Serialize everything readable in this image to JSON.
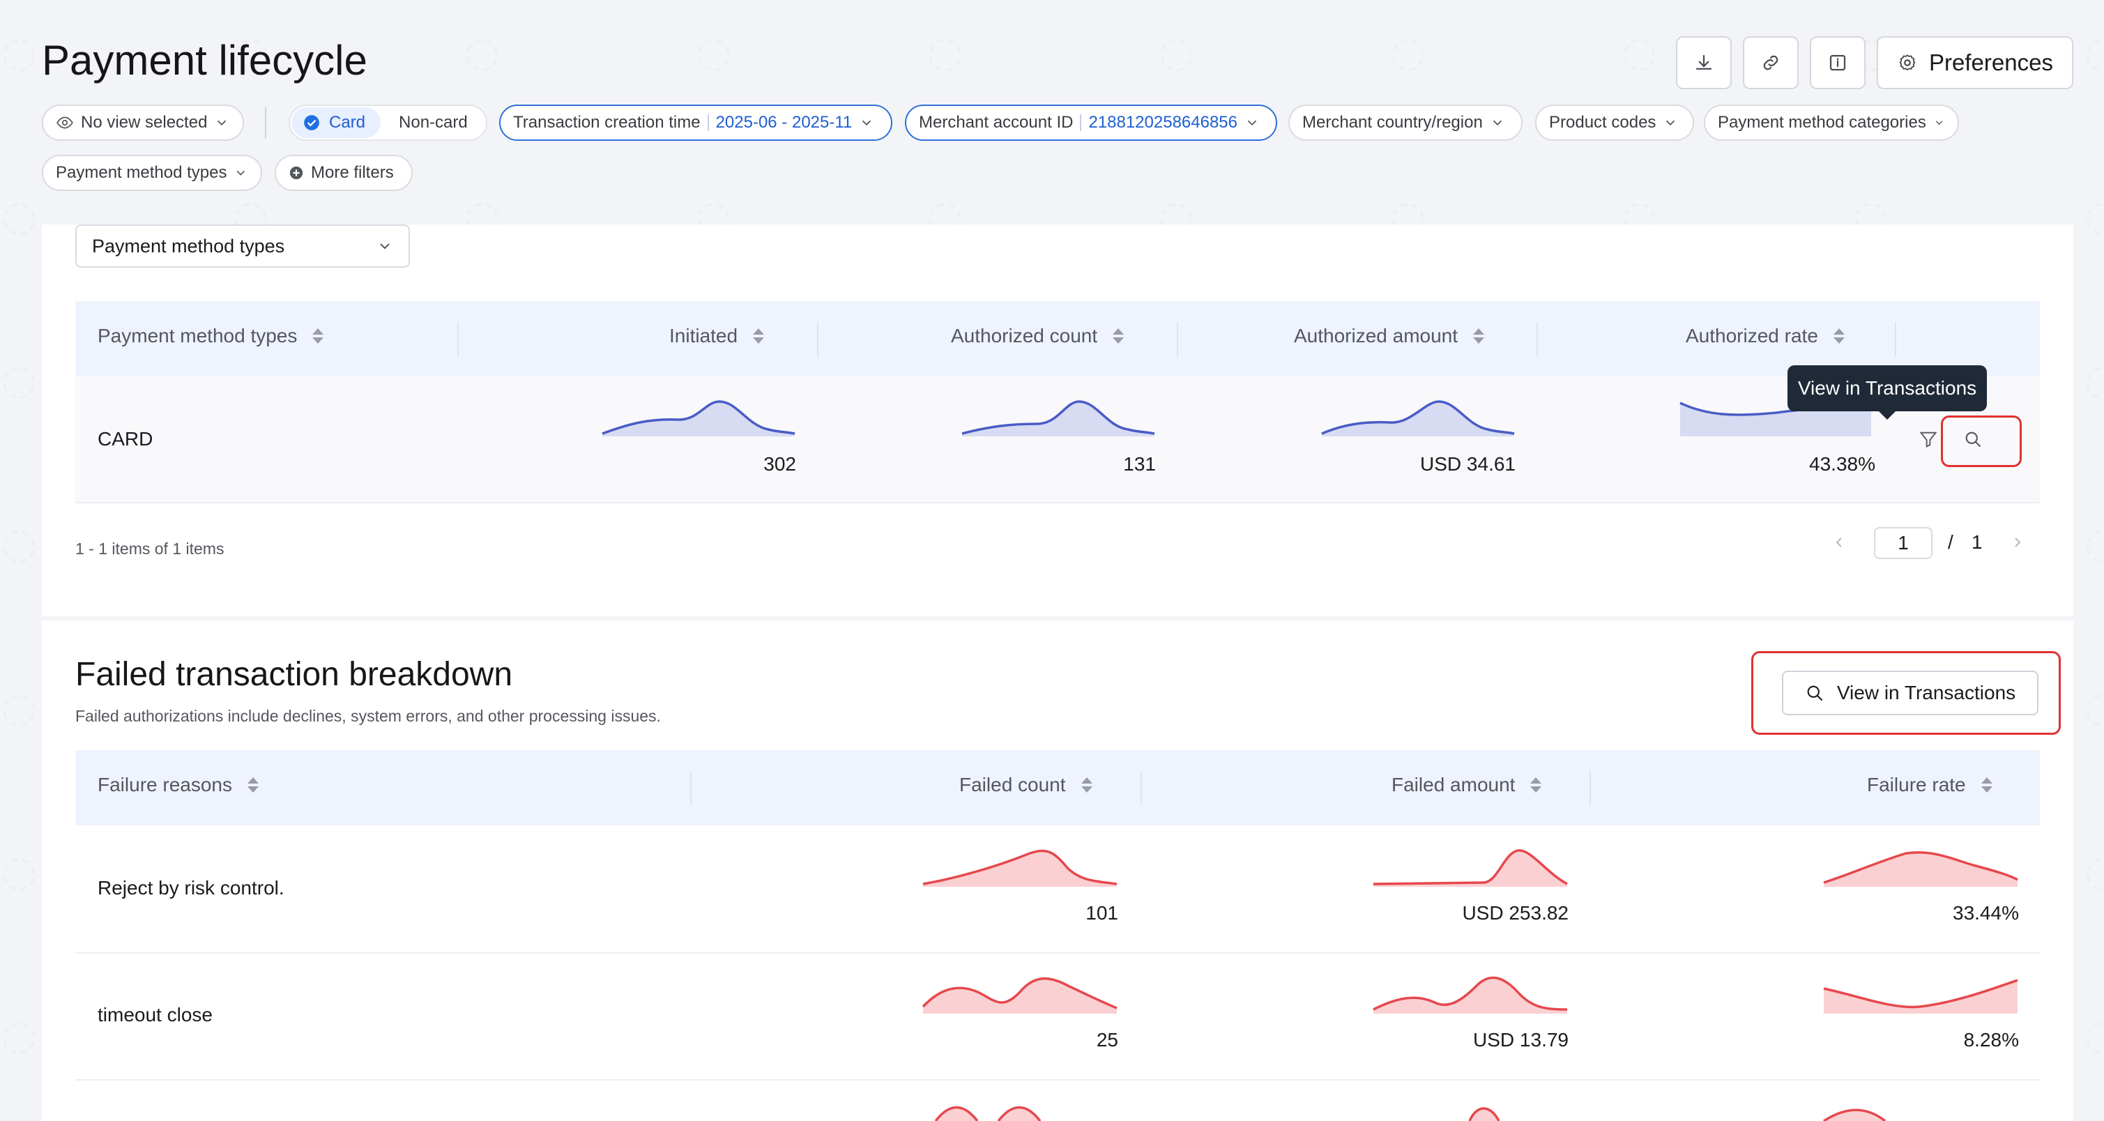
{
  "header": {
    "title": "Payment lifecycle",
    "preferences_label": "Preferences",
    "icons": [
      "download-icon",
      "link-icon",
      "info-icon",
      "gear-icon"
    ]
  },
  "filters": {
    "view_select": "No view selected",
    "segment": {
      "selected": "Card",
      "other": "Non-card"
    },
    "transaction_time": {
      "label": "Transaction creation time",
      "value": "2025-06 - 2025-11"
    },
    "merchant_account": {
      "label": "Merchant account ID",
      "value": "2188120258646856"
    },
    "merchant_country": "Merchant country/region",
    "product_codes": "Product codes",
    "payment_method_categories": "Payment method categories",
    "payment_method_types": "Payment method types",
    "more_filters": "More filters"
  },
  "dimension_select": "Payment method types",
  "pm_table": {
    "columns": [
      "Payment method types",
      "Initiated",
      "Authorized count",
      "Authorized amount",
      "Authorized rate"
    ],
    "rows": [
      {
        "name": "CARD",
        "initiated": "302",
        "authorized_count": "131",
        "authorized_amount": "USD 34.61",
        "authorized_rate": "43.38%"
      }
    ],
    "tooltip": "View in Transactions",
    "pagination_summary": "1 - 1 items of 1 items",
    "page": "1",
    "page_sep": "/",
    "total_pages": "1"
  },
  "failed": {
    "title": "Failed transaction breakdown",
    "subtitle": "Failed authorizations include declines, system errors, and other processing issues.",
    "view_button": "View in Transactions",
    "columns": [
      "Failure reasons",
      "Failed count",
      "Failed amount",
      "Failure rate"
    ],
    "rows": [
      {
        "reason": "Reject by risk control.",
        "count": "101",
        "amount": "USD 253.82",
        "rate": "33.44%"
      },
      {
        "reason": "timeout close",
        "count": "25",
        "amount": "USD 13.79",
        "rate": "8.28%"
      }
    ]
  },
  "colors": {
    "accent": "#1f5fd0",
    "spark_blue": "#4a5cc5",
    "spark_blue_fill": "#d7dcf3",
    "spark_red": "#e5484d",
    "spark_red_fill": "#fbd0d2",
    "highlight": "#e03131"
  }
}
